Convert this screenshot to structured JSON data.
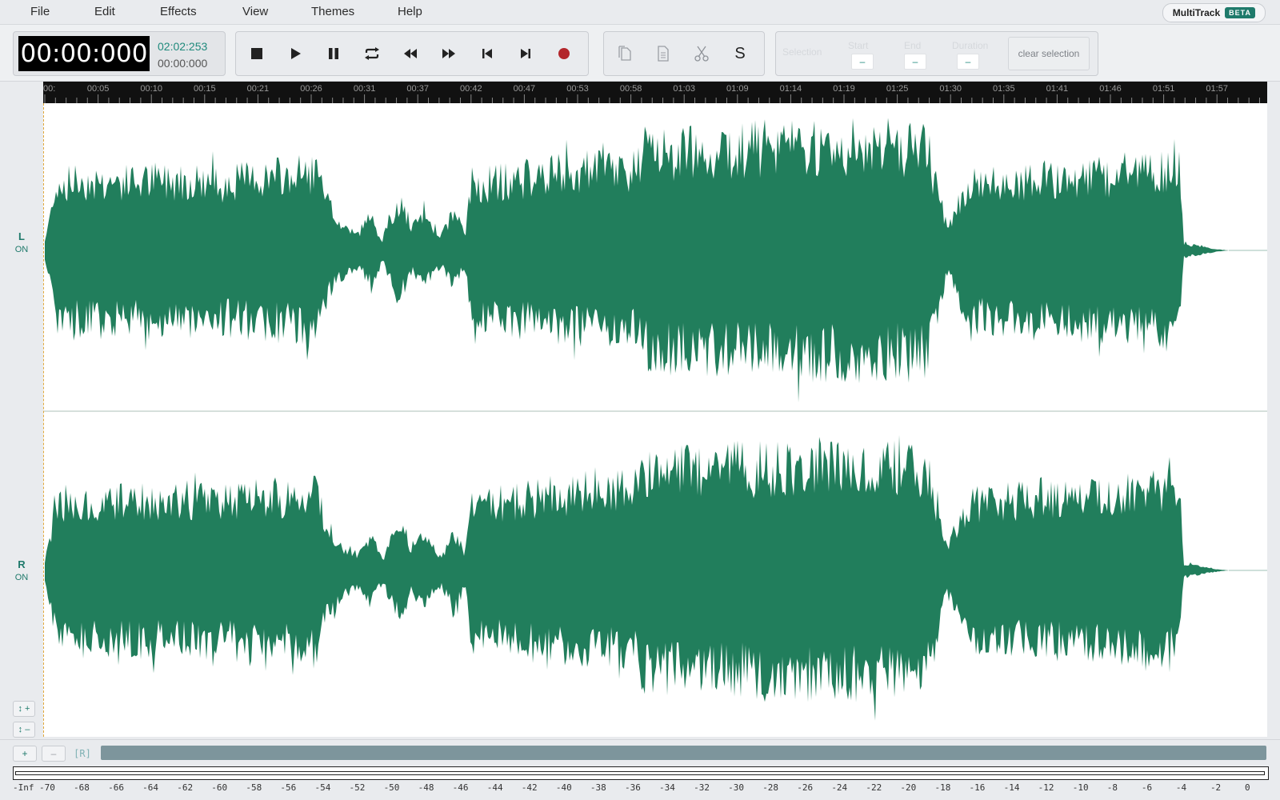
{
  "menu": {
    "items": [
      "File",
      "Edit",
      "Effects",
      "View",
      "Themes",
      "Help"
    ]
  },
  "brand": {
    "name": "MultiTrack",
    "badge": "BETA"
  },
  "clock": {
    "current": "00:00:000",
    "total": "02:02:253",
    "selection": "00:00:000"
  },
  "transport": {
    "buttons": [
      "stop-icon",
      "play-icon",
      "pause-icon",
      "loop-icon",
      "rewind-icon",
      "fast-forward-icon",
      "skip-back-icon",
      "skip-forward-icon",
      "record-icon"
    ],
    "record_color": "#b3262b"
  },
  "edit": {
    "buttons": [
      "copy-icon",
      "paste-icon",
      "cut-icon"
    ],
    "silence_label": "S"
  },
  "selection": {
    "label": "Selection",
    "start_label": "Start",
    "end_label": "End",
    "duration_label": "Duration",
    "start_value": "–",
    "end_value": "–",
    "duration_value": "–",
    "clear_label": "clear selection"
  },
  "timeline": {
    "ticks": [
      "00:",
      "00:05",
      "00:10",
      "00:15",
      "00:21",
      "00:26",
      "00:31",
      "00:37",
      "00:42",
      "00:47",
      "00:53",
      "00:58",
      "01:03",
      "01:09",
      "01:14",
      "01:19",
      "01:25",
      "01:30",
      "01:35",
      "01:41",
      "01:46",
      "01:51",
      "01:57"
    ]
  },
  "channels": [
    {
      "letter": "L",
      "state": "ON"
    },
    {
      "letter": "R",
      "state": "ON"
    }
  ],
  "waveform": {
    "color": "#217e5c",
    "envelope": [
      [
        0.0,
        0.08
      ],
      [
        0.01,
        0.58
      ],
      [
        0.03,
        0.62
      ],
      [
        0.06,
        0.6
      ],
      [
        0.09,
        0.62
      ],
      [
        0.12,
        0.63
      ],
      [
        0.15,
        0.6
      ],
      [
        0.18,
        0.64
      ],
      [
        0.21,
        0.66
      ],
      [
        0.229,
        0.7
      ],
      [
        0.237,
        0.44
      ],
      [
        0.25,
        0.22
      ],
      [
        0.265,
        0.14
      ],
      [
        0.275,
        0.3
      ],
      [
        0.285,
        0.1
      ],
      [
        0.3,
        0.42
      ],
      [
        0.31,
        0.18
      ],
      [
        0.32,
        0.32
      ],
      [
        0.335,
        0.12
      ],
      [
        0.345,
        0.34
      ],
      [
        0.355,
        0.14
      ],
      [
        0.36,
        0.58
      ],
      [
        0.38,
        0.6
      ],
      [
        0.42,
        0.66
      ],
      [
        0.46,
        0.7
      ],
      [
        0.5,
        0.72
      ],
      [
        0.505,
        0.86
      ],
      [
        0.54,
        0.88
      ],
      [
        0.58,
        0.9
      ],
      [
        0.62,
        0.92
      ],
      [
        0.66,
        0.93
      ],
      [
        0.7,
        0.92
      ],
      [
        0.745,
        0.9
      ],
      [
        0.762,
        0.2
      ],
      [
        0.78,
        0.58
      ],
      [
        0.82,
        0.62
      ],
      [
        0.86,
        0.64
      ],
      [
        0.9,
        0.66
      ],
      [
        0.94,
        0.7
      ],
      [
        0.958,
        0.72
      ],
      [
        0.962,
        0.06
      ],
      [
        0.99,
        0.01
      ],
      [
        1.0,
        0.0
      ]
    ]
  },
  "track": {
    "zoom_in": "+",
    "zoom_out": "–",
    "vzoom_in": "↕ +",
    "vzoom_out": "↕ –",
    "reverse_label": "[R]"
  },
  "meter": {
    "labels": [
      "-Inf",
      "-70",
      "-68",
      "-66",
      "-64",
      "-62",
      "-60",
      "-58",
      "-56",
      "-54",
      "-52",
      "-50",
      "-48",
      "-46",
      "-44",
      "-42",
      "-40",
      "-38",
      "-36",
      "-34",
      "-32",
      "-30",
      "-28",
      "-26",
      "-24",
      "-22",
      "-20",
      "-18",
      "-16",
      "-14",
      "-12",
      "-10",
      "-8",
      "-6",
      "-4",
      "-2",
      "0"
    ]
  }
}
